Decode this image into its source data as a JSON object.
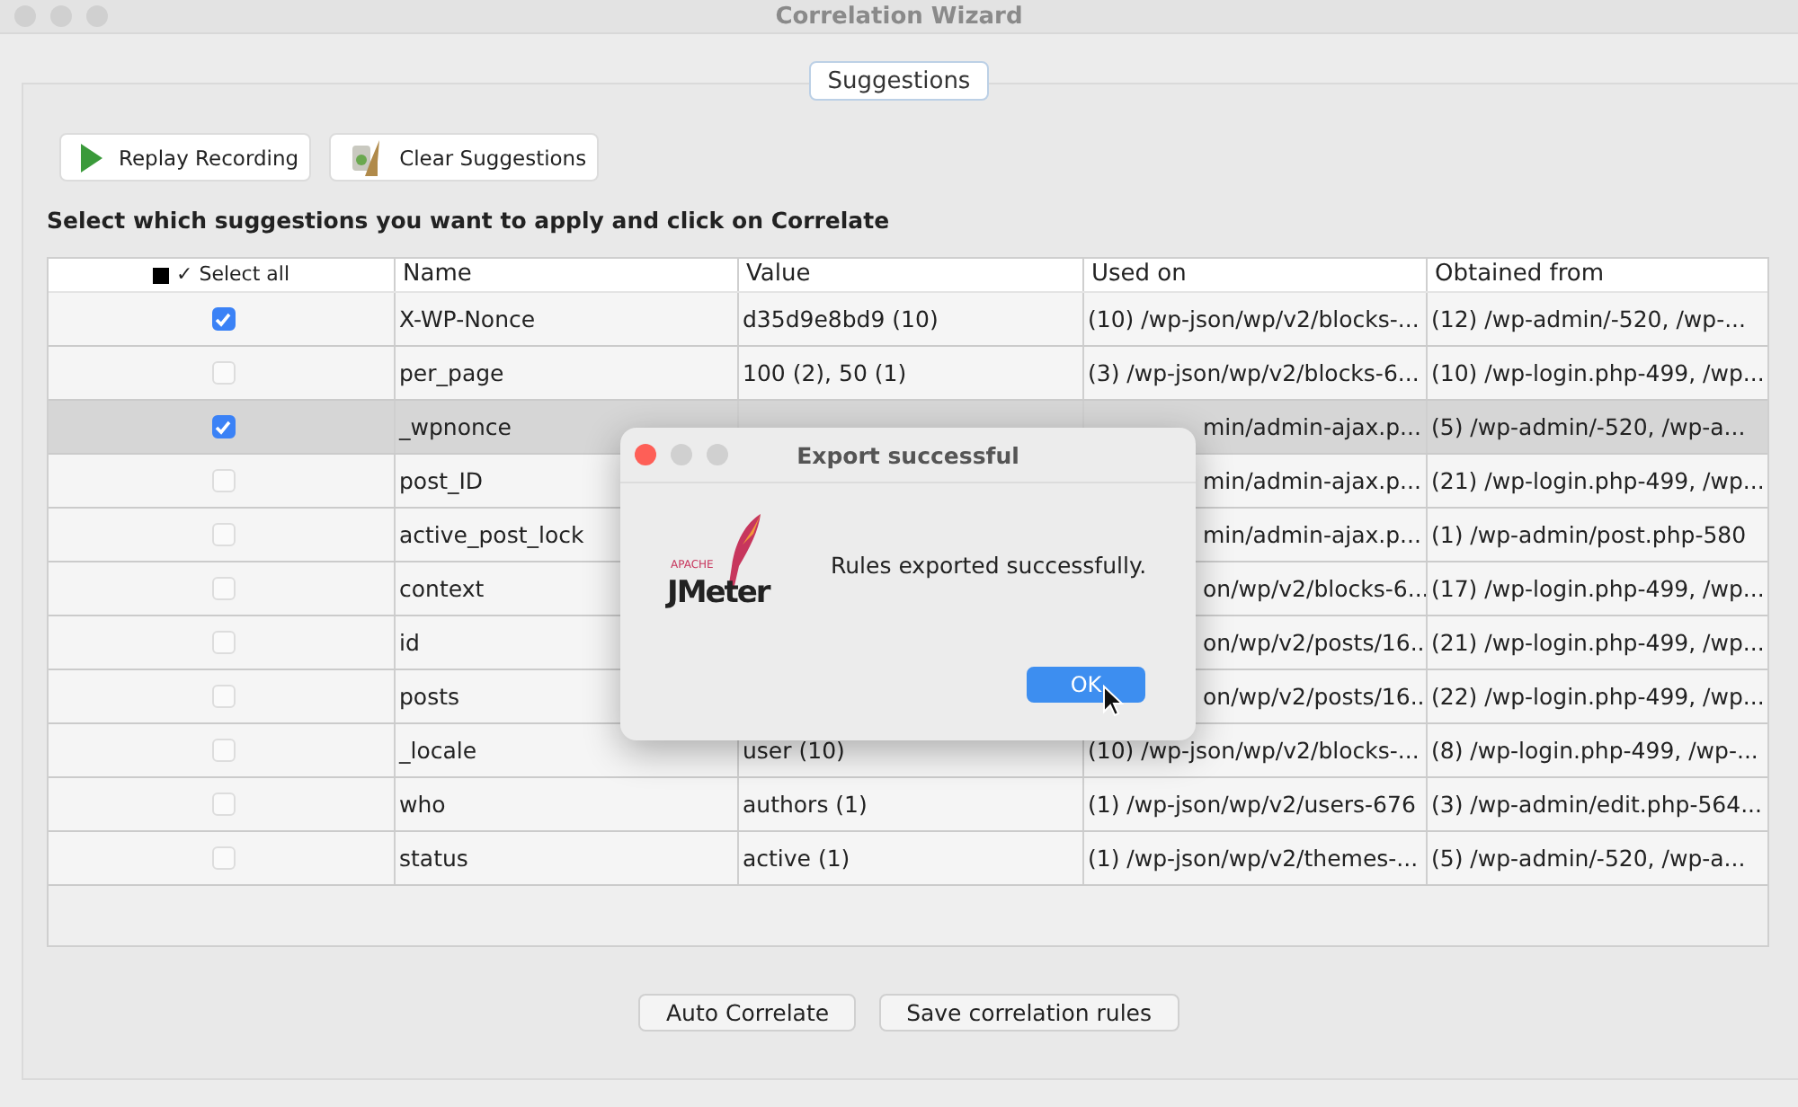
{
  "window": {
    "title": "Correlation Wizard"
  },
  "tabs": [
    {
      "label": "Suggestions",
      "selected": true
    }
  ],
  "toolbar": [
    {
      "label": "Replay Recording",
      "kind": "play"
    },
    {
      "label": "Clear Suggestions",
      "kind": "broom"
    }
  ],
  "instruction": "Select which suggestions you want to apply and click on Correlate",
  "table": {
    "select_all_checked": true,
    "select_all": "✓ Select all",
    "columns": [
      "Name",
      "Value",
      "Used on",
      "Obtained from"
    ],
    "rows": [
      {
        "checked": true,
        "selected": false,
        "name": "X-WP-Nonce",
        "value": "d35d9e8bd9 (10)",
        "used_on": "(10) /wp-json/wp/v2/blocks-...",
        "used_on_clipped": false,
        "obtained_from": "(12) /wp-admin/-520, /wp-..."
      },
      {
        "checked": false,
        "selected": false,
        "name": "per_page",
        "value": "100 (2), 50 (1)",
        "used_on": "(3) /wp-json/wp/v2/blocks-6...",
        "used_on_clipped": false,
        "obtained_from": "(10) /wp-login.php-499, /wp..."
      },
      {
        "checked": true,
        "selected": true,
        "name": "_wpnonce",
        "used_on": "min/admin-ajax.p...",
        "used_on_clipped": true,
        "obtained_from": "(5) /wp-admin/-520, /wp-a..."
      },
      {
        "checked": false,
        "selected": false,
        "name": "post_ID",
        "used_on": "min/admin-ajax.p...",
        "used_on_clipped": true,
        "obtained_from": "(21) /wp-login.php-499, /wp..."
      },
      {
        "checked": false,
        "selected": false,
        "name": "active_post_lock",
        "used_on": "min/admin-ajax.p...",
        "used_on_clipped": true,
        "obtained_from": "(1) /wp-admin/post.php-580"
      },
      {
        "checked": false,
        "selected": false,
        "name": "context",
        "used_on": "on/wp/v2/blocks-6...",
        "used_on_clipped": true,
        "obtained_from": "(17) /wp-login.php-499, /wp..."
      },
      {
        "checked": false,
        "selected": false,
        "name": "id",
        "used_on": "on/wp/v2/posts/16...",
        "used_on_clipped": true,
        "obtained_from": "(21) /wp-login.php-499, /wp..."
      },
      {
        "checked": false,
        "selected": false,
        "name": "posts",
        "used_on": "on/wp/v2/posts/16...",
        "used_on_clipped": true,
        "obtained_from": "(22) /wp-login.php-499, /wp..."
      },
      {
        "checked": false,
        "selected": false,
        "name": "_locale",
        "value": "user (10)",
        "used_on": "(10) /wp-json/wp/v2/blocks-...",
        "used_on_clipped": false,
        "obtained_from": "(8) /wp-login.php-499, /wp-..."
      },
      {
        "checked": false,
        "selected": false,
        "name": "who",
        "value": "authors (1)",
        "used_on": "(1) /wp-json/wp/v2/users-676",
        "used_on_clipped": false,
        "obtained_from": "(3) /wp-admin/edit.php-564..."
      },
      {
        "checked": false,
        "selected": false,
        "name": "status",
        "value": "active (1)",
        "used_on": "(1) /wp-json/wp/v2/themes-...",
        "used_on_clipped": false,
        "obtained_from": "(5) /wp-admin/-520, /wp-a..."
      }
    ]
  },
  "dialog": {
    "title": "Export successful",
    "logo": {
      "small": "APACHE",
      "name": "JMeter"
    },
    "message": "Rules exported successfully.",
    "button": "OK"
  },
  "buttons": [
    "Auto Correlate",
    "Save correlation rules"
  ]
}
